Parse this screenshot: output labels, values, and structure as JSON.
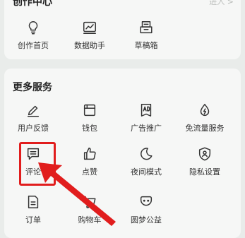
{
  "creation_center": {
    "title": "创作中心",
    "enter": "进入 >",
    "items": [
      {
        "label": "创作首页",
        "icon": "lightbulb-icon"
      },
      {
        "label": "数据助手",
        "icon": "chart-icon"
      },
      {
        "label": "草稿箱",
        "icon": "drafts-icon"
      }
    ]
  },
  "more_services": {
    "title": "更多服务",
    "items": [
      {
        "label": "用户反馈",
        "icon": "edit-icon"
      },
      {
        "label": "钱包",
        "icon": "wallet-icon"
      },
      {
        "label": "广告推广",
        "icon": "ad-icon"
      },
      {
        "label": "免流量服务",
        "icon": "data-drop-icon"
      },
      {
        "label": "评论",
        "icon": "comment-icon"
      },
      {
        "label": "点赞",
        "icon": "thumbs-up-icon"
      },
      {
        "label": "夜间模式",
        "icon": "moon-icon"
      },
      {
        "label": "隐私设置",
        "icon": "privacy-shield-icon"
      },
      {
        "label": "订单",
        "icon": "order-icon"
      },
      {
        "label": "购物车",
        "icon": "cart-icon"
      },
      {
        "label": "圆梦公益",
        "icon": "charity-icon"
      }
    ]
  },
  "annotation": {
    "highlight_color": "#e11d1d"
  }
}
